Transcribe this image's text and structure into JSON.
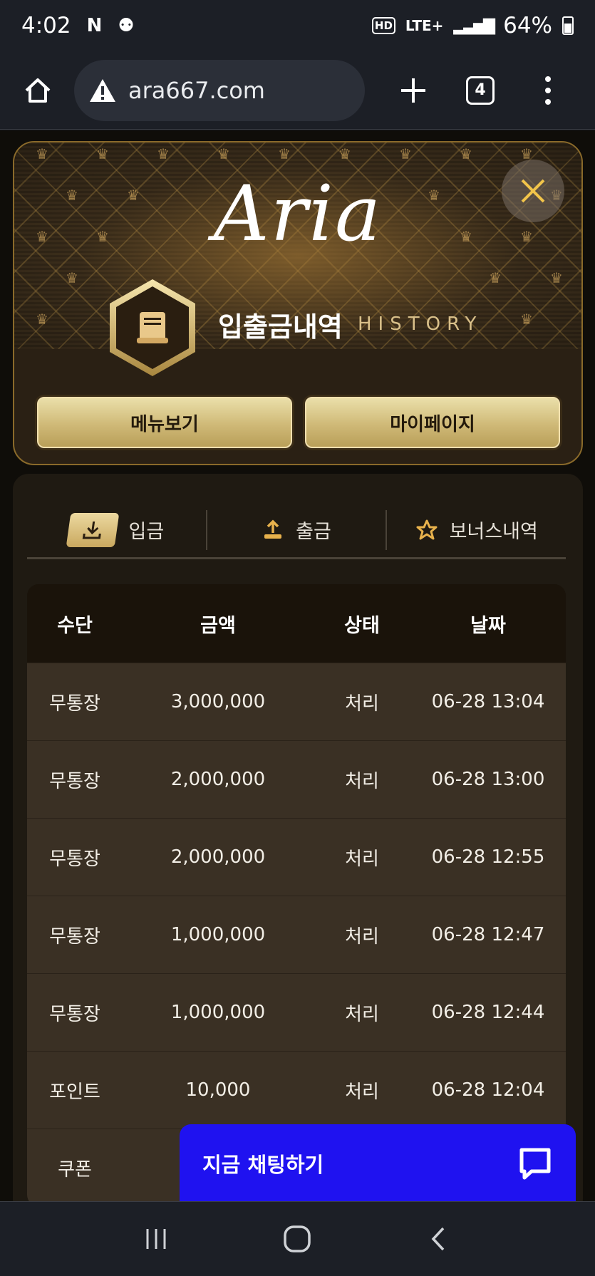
{
  "status_bar": {
    "time": "4:02",
    "network": "LTE+",
    "battery": "64%",
    "icons": [
      "netflix-icon",
      "notification-icon",
      "hd-icon",
      "signal-icon",
      "battery-icon"
    ]
  },
  "browser": {
    "url": "ara667.com",
    "tab_count": "4"
  },
  "header": {
    "logo": "Aria",
    "title_ko": "입출금내역",
    "title_en": "HISTORY",
    "buttons": {
      "menu": "메뉴보기",
      "mypage": "마이페이지"
    }
  },
  "tabs": [
    {
      "label": "입금",
      "icon": "download-icon",
      "active": true
    },
    {
      "label": "출금",
      "icon": "upload-icon",
      "active": false
    },
    {
      "label": "보너스내역",
      "icon": "star-icon",
      "active": false
    }
  ],
  "table": {
    "headers": [
      "수단",
      "금액",
      "상태",
      "날짜"
    ],
    "rows": [
      [
        "무통장",
        "3,000,000",
        "처리",
        "06-28 13:04"
      ],
      [
        "무통장",
        "2,000,000",
        "처리",
        "06-28 13:00"
      ],
      [
        "무통장",
        "2,000,000",
        "처리",
        "06-28 12:55"
      ],
      [
        "무통장",
        "1,000,000",
        "처리",
        "06-28 12:47"
      ],
      [
        "무통장",
        "1,000,000",
        "처리",
        "06-28 12:44"
      ],
      [
        "포인트",
        "10,000",
        "처리",
        "06-28 12:04"
      ],
      [
        "쿠폰",
        "",
        "",
        ""
      ]
    ]
  },
  "chat": {
    "label": "지금 채팅하기",
    "color": "#1f12f0"
  },
  "colors": {
    "gold": "#cfb977",
    "accent_blue": "#1f12f0"
  }
}
